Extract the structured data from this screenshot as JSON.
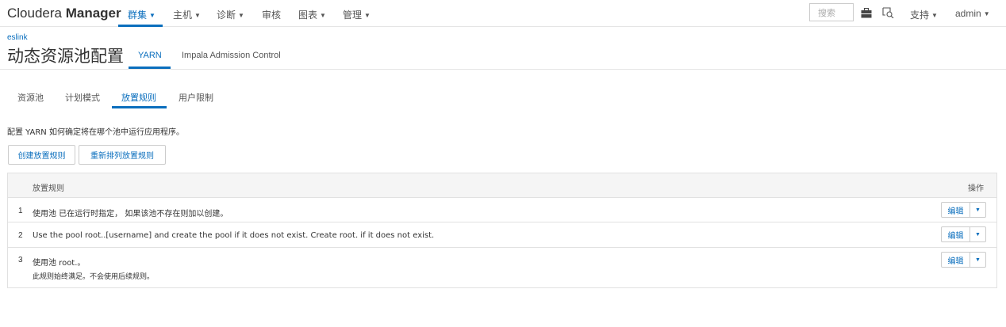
{
  "brand": {
    "light": "Cloudera ",
    "bold": "Manager"
  },
  "nav": {
    "items": [
      {
        "label": "群集",
        "caret": "▼",
        "active": true
      },
      {
        "label": "主机",
        "caret": "▼"
      },
      {
        "label": "诊断",
        "caret": "▼"
      },
      {
        "label": "审核"
      },
      {
        "label": "图表",
        "caret": "▼"
      },
      {
        "label": "管理",
        "caret": "▼"
      }
    ],
    "search_placeholder": "搜索",
    "support_label": "支持",
    "user_label": "admin",
    "caret": "▼"
  },
  "header": {
    "breadcrumb": "eslink",
    "title": "动态资源池配置",
    "tabs": [
      {
        "label": "YARN",
        "active": true
      },
      {
        "label": "Impala Admission Control"
      }
    ]
  },
  "subtabs": [
    {
      "label": "资源池"
    },
    {
      "label": "计划模式"
    },
    {
      "label": "放置规则",
      "active": true
    },
    {
      "label": "用户限制"
    }
  ],
  "description": "配置 YARN 如何确定将在哪个池中运行应用程序。",
  "buttons": {
    "create": "创建放置规则",
    "reorder": "重新排列放置规则"
  },
  "table": {
    "headers": {
      "rule": "放置规则",
      "actions": "操作"
    },
    "rows": [
      {
        "num": "1",
        "text": "使用池 已在运行时指定， 如果该池不存在则加以创建。",
        "sub": ""
      },
      {
        "num": "2",
        "text": "Use the pool root..[username] and create the pool if it does not exist. Create root. if it does not exist.",
        "sub": ""
      },
      {
        "num": "3",
        "text": "使用池 root.。",
        "sub": "此规则始终满足。不会使用后续规则。"
      }
    ],
    "edit_label": "编辑",
    "caret": "▼"
  },
  "colors": {
    "accent": "#0a6ebd",
    "border": "#e1e1e1",
    "header_bg": "#f5f5f5"
  },
  "icons": [
    "briefcase-icon",
    "search-messages-icon",
    "dropdown-caret-icon"
  ]
}
